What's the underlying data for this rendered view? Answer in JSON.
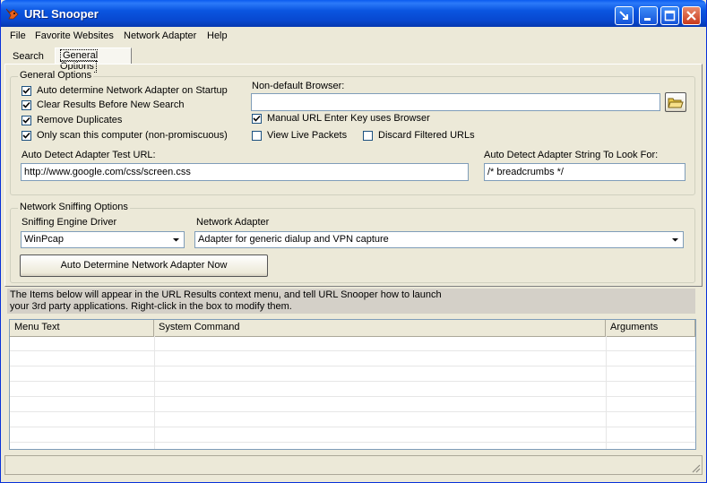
{
  "window": {
    "title": "URL Snooper"
  },
  "menu": {
    "items": [
      "File",
      "Favorite Websites",
      "Network Adapter",
      "Help"
    ]
  },
  "tabs": {
    "search": "Search",
    "general": "General Options"
  },
  "general_options": {
    "title": "General Options",
    "checkboxes": [
      {
        "label": "Auto determine Network Adapter on Startup",
        "checked": true
      },
      {
        "label": "Clear Results Before New Search",
        "checked": true
      },
      {
        "label": "Remove Duplicates",
        "checked": true
      },
      {
        "label": "Only scan this computer (non-promiscuous)",
        "checked": true
      }
    ],
    "non_default_browser_label": "Non-default Browser:",
    "non_default_browser_value": "",
    "manual_url_label": "Manual URL Enter Key uses Browser",
    "manual_url_checked": true,
    "view_live_label": "View Live Packets",
    "view_live_checked": false,
    "discard_filtered_label": "Discard Filtered URLs",
    "discard_filtered_checked": false,
    "test_url_label": "Auto Detect Adapter Test URL:",
    "test_url_value": "http://www.google.com/css/screen.css",
    "adapter_string_label": "Auto Detect Adapter String To Look For:",
    "adapter_string_value": "/* breadcrumbs */"
  },
  "network_sniffing": {
    "title": "Network Sniffing Options",
    "engine_label": "Sniffing Engine Driver",
    "engine_value": "WinPcap",
    "adapter_label": "Network Adapter",
    "adapter_value": "Adapter for generic dialup and VPN capture",
    "auto_button": "Auto Determine Network Adapter Now"
  },
  "info_text": {
    "line1": "The Items below will appear in the URL Results context menu, and tell URL Snooper how to launch",
    "line2": "your 3rd party applications.  Right-click in the box to modify them."
  },
  "commands_table": {
    "columns": [
      "Menu Text",
      "System Command",
      "Arguments"
    ],
    "rows": []
  },
  "colors": {
    "titlebar": "#0a55e0",
    "window_bg": "#ece9d8",
    "close_button": "#c8391c"
  },
  "icons": [
    "app-fox-icon",
    "restore-arrow-icon",
    "minimize-icon",
    "maximize-icon",
    "close-icon",
    "folder-open-icon",
    "chevron-down-icon",
    "resize-grip-icon"
  ]
}
